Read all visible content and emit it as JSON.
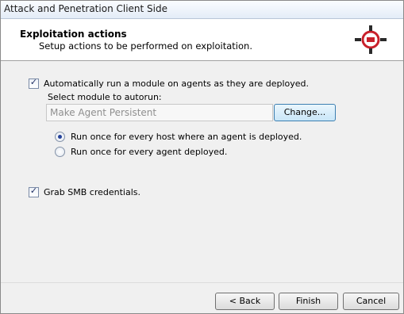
{
  "window": {
    "title": "Attack and Penetration Client Side"
  },
  "header": {
    "title": "Exploitation actions",
    "subtitle": "Setup actions to be performed on exploitation."
  },
  "icons": {
    "logo": "crosshair-logo-icon",
    "checkbox_mark": "checkmark-icon"
  },
  "colors": {
    "logo_red": "#c8202a",
    "logo_dark": "#2a2a2a",
    "accent_blue": "#3c7fb1"
  },
  "options": {
    "auto_run": {
      "label": "Automatically run a module on agents as they are deployed.",
      "checked": true
    },
    "select_module_label": "Select module to autorun:",
    "module_value": "Make Agent Persistent",
    "change_button": "Change...",
    "run_mode": {
      "selected": "per_host",
      "per_host_label": "Run once for every host where an agent is deployed.",
      "per_agent_label": "Run once for every agent deployed."
    },
    "grab_smb": {
      "label": "Grab SMB credentials.",
      "checked": true
    }
  },
  "footer": {
    "back_label": "< Back",
    "finish_label": "Finish",
    "cancel_label": "Cancel"
  }
}
